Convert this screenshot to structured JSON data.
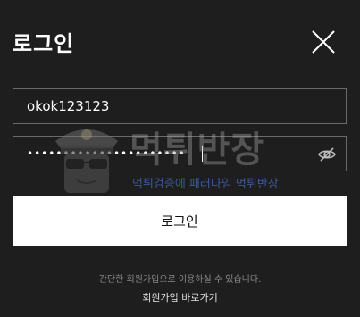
{
  "dialog": {
    "title": "로그인"
  },
  "form": {
    "id_value": "okok123123",
    "password_value": "••••••••••••••••••••••",
    "submit_label": "로그인"
  },
  "footer": {
    "hint": "간단한 회원가입으로 이용하실 수 있습니다.",
    "signup_link": "회원가입 바로가기"
  },
  "watermark": {
    "main": "먹튀반장",
    "sub": "먹튀검증에 패러다임 먹튀반장"
  },
  "icons": {
    "close": "close-icon",
    "eye": "eye-slash-icon"
  },
  "colors": {
    "background": "#1e1e1e",
    "button": "#ffffff",
    "border": "#6a6a6a"
  }
}
